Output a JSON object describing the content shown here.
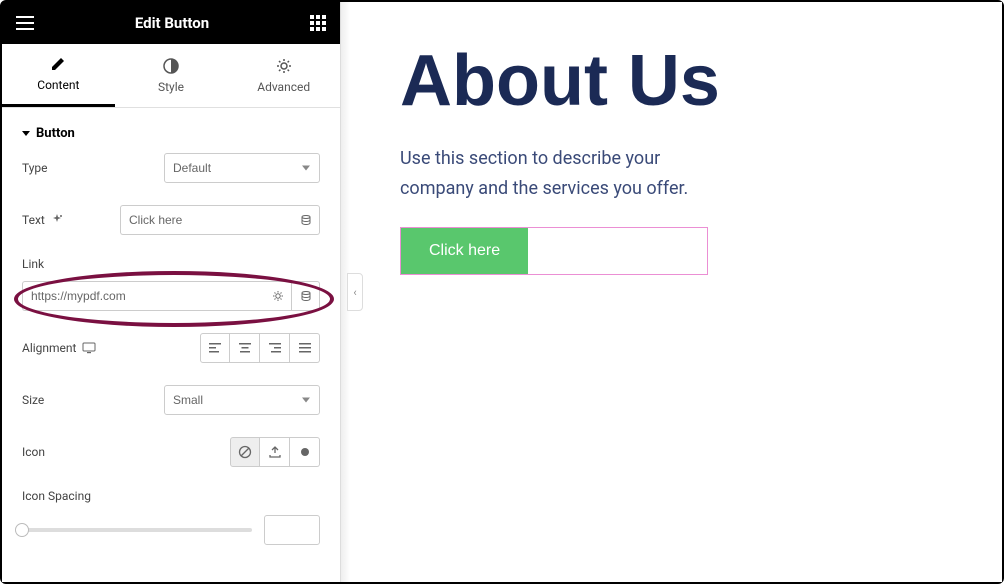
{
  "topbar": {
    "title": "Edit Button"
  },
  "tabs": {
    "content_label": "Content",
    "style_label": "Style",
    "advanced_label": "Advanced"
  },
  "section": {
    "title": "Button"
  },
  "controls": {
    "type": {
      "label": "Type",
      "value": "Default"
    },
    "text": {
      "label": "Text",
      "value": "Click here"
    },
    "link": {
      "label": "Link",
      "value": "https://mypdf.com"
    },
    "alignment": {
      "label": "Alignment"
    },
    "size": {
      "label": "Size",
      "value": "Small"
    },
    "icon": {
      "label": "Icon"
    },
    "icon_spacing": {
      "label": "Icon Spacing"
    }
  },
  "preview": {
    "heading": "About Us",
    "paragraph": "Use this section to describe your company and the services you offer.",
    "button_label": "Click here"
  }
}
